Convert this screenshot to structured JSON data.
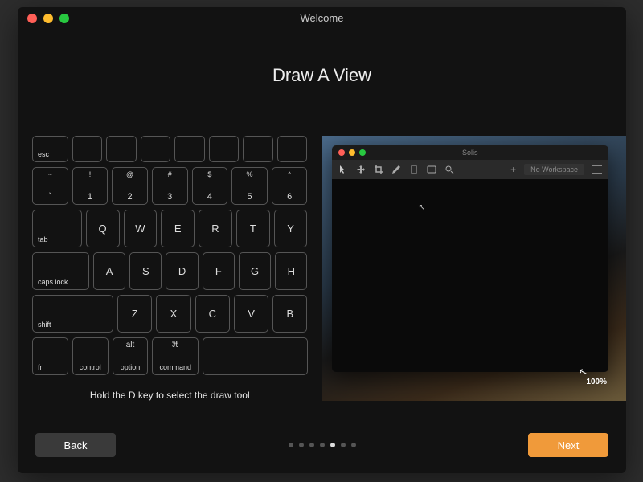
{
  "window": {
    "title": "Welcome"
  },
  "heading": "Draw A View",
  "hint": "Hold the D key to select the draw tool",
  "keyboard": {
    "esc": "esc",
    "num_row": [
      {
        "top": "~",
        "bot": "`"
      },
      {
        "top": "!",
        "bot": "1"
      },
      {
        "top": "@",
        "bot": "2"
      },
      {
        "top": "#",
        "bot": "3"
      },
      {
        "top": "$",
        "bot": "4"
      },
      {
        "top": "%",
        "bot": "5"
      },
      {
        "top": "^",
        "bot": "6"
      }
    ],
    "tab": "tab",
    "qwerty": [
      "Q",
      "W",
      "E",
      "R",
      "T",
      "Y"
    ],
    "caps": "caps lock",
    "asdf": [
      "A",
      "S",
      "D",
      "F",
      "G",
      "H"
    ],
    "shift": "shift",
    "zxcv": [
      "Z",
      "X",
      "C",
      "V",
      "B"
    ],
    "bottom": {
      "fn": "fn",
      "control": "control",
      "option": "option",
      "option_sym": "alt",
      "command": "command",
      "command_sym": "⌘"
    }
  },
  "preview": {
    "title": "Solis",
    "workspace_label": "No Workspace",
    "zoom": "100%",
    "icons": [
      "cursor",
      "move",
      "crop",
      "pencil",
      "phone",
      "tablet",
      "search"
    ]
  },
  "pager": {
    "count": 7,
    "active": 4
  },
  "buttons": {
    "back": "Back",
    "next": "Next"
  }
}
